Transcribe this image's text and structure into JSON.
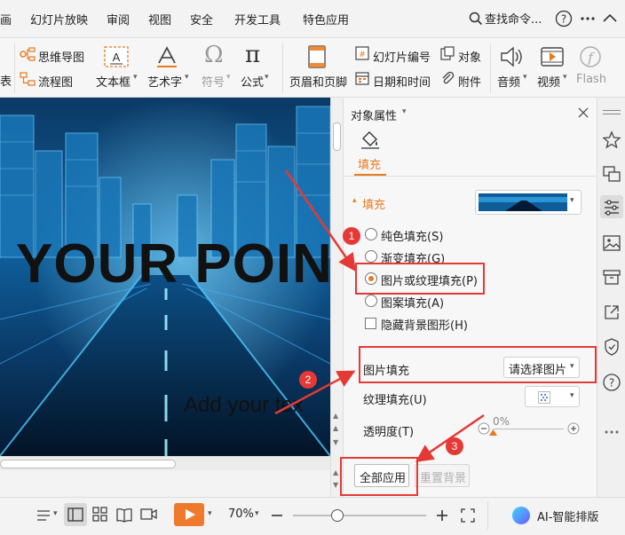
{
  "menubar": {
    "items": [
      "画",
      "幻灯片放映",
      "审阅",
      "视图",
      "安全",
      "开发工具",
      "特色应用"
    ],
    "search_label": "查找命令..."
  },
  "ribbon": {
    "partial_label": "表",
    "mindmap": "思维导图",
    "flowchart": "流程图",
    "textbox": "文本框",
    "wordart": "艺术字",
    "symbol": "符号",
    "formula": "公式",
    "header_footer": "页眉和页脚",
    "slide_number": "幻灯片编号",
    "object": "对象",
    "datetime": "日期和时间",
    "attachment": "附件",
    "audio": "音频",
    "video": "视频",
    "flash": "Flash"
  },
  "slide": {
    "title": "YOUR POIN",
    "subtitle": "Add your tex"
  },
  "panel": {
    "header": "对象属性",
    "tab_fill": "填充",
    "section_fill": "填充",
    "options": [
      {
        "label": "纯色填充(S)",
        "selected": false
      },
      {
        "label": "渐变填充(G)",
        "selected": false
      },
      {
        "label": "图片或纹理填充(P)",
        "selected": true
      },
      {
        "label": "图案填充(A)",
        "selected": false
      }
    ],
    "hide_bg": "隐藏背景图形(H)",
    "picture_fill_label": "图片填充",
    "picture_fill_value": "请选择图片",
    "texture_fill_label": "纹理填充(U)",
    "transparency_label": "透明度(T)",
    "transparency_value": "0%",
    "apply_all": "全部应用",
    "reset_bg": "重置背景"
  },
  "annotations": [
    "1",
    "2",
    "3"
  ],
  "status": {
    "zoom": "70%",
    "ai_label": "AI-智能排版"
  },
  "colors": {
    "accent": "#e8791e",
    "annotation": "#e53935",
    "play_button": "#f07a2c"
  }
}
